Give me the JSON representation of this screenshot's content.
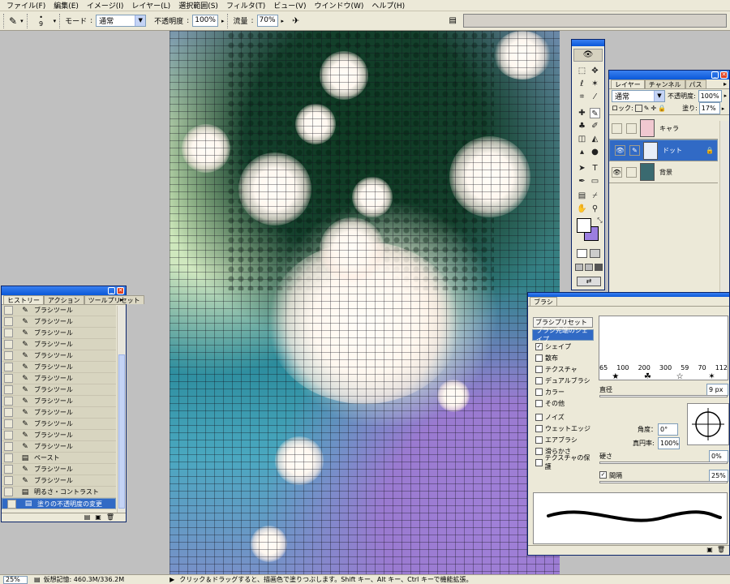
{
  "menu": [
    "ファイル(F)",
    "編集(E)",
    "イメージ(I)",
    "レイヤー(L)",
    "選択範囲(S)",
    "フィルタ(T)",
    "ビュー(V)",
    "ウインドウ(W)",
    "ヘルプ(H)"
  ],
  "options": {
    "brush_size": "9",
    "mode_label": "モード",
    "mode_value": "通常",
    "opacity_label": "不透明度",
    "opacity_value": "100%",
    "flow_label": "流量",
    "flow_value": "70%"
  },
  "history": {
    "tabs": [
      "ヒストリー",
      "アクション",
      "ツールプリセット"
    ],
    "items": [
      {
        "label": "ブラシツール",
        "icon": "brush-icon"
      },
      {
        "label": "ブラシツール",
        "icon": "brush-icon"
      },
      {
        "label": "ブラシツール",
        "icon": "brush-icon"
      },
      {
        "label": "ブラシツール",
        "icon": "brush-icon"
      },
      {
        "label": "ブラシツール",
        "icon": "brush-icon"
      },
      {
        "label": "ブラシツール",
        "icon": "brush-icon"
      },
      {
        "label": "ブラシツール",
        "icon": "brush-icon"
      },
      {
        "label": "ブラシツール",
        "icon": "brush-icon"
      },
      {
        "label": "ブラシツール",
        "icon": "brush-icon"
      },
      {
        "label": "ブラシツール",
        "icon": "brush-icon"
      },
      {
        "label": "ブラシツール",
        "icon": "brush-icon"
      },
      {
        "label": "ブラシツール",
        "icon": "brush-icon"
      },
      {
        "label": "ブラシツール",
        "icon": "brush-icon"
      },
      {
        "label": "ペースト",
        "icon": "document-icon"
      },
      {
        "label": "ブラシツール",
        "icon": "brush-icon"
      },
      {
        "label": "ブラシツール",
        "icon": "brush-icon"
      },
      {
        "label": "明るさ・コントラスト",
        "icon": "document-icon"
      },
      {
        "label": "塗りの不透明度の変更",
        "icon": "document-icon"
      }
    ]
  },
  "layers": {
    "tabs": [
      "レイヤー",
      "チャンネル",
      "パス"
    ],
    "blend": "通常",
    "opacity_label": "不透明度:",
    "opacity_value": "100%",
    "lock_label": "ロック:",
    "fill_label": "塗り:",
    "fill_value": "17%",
    "items": [
      {
        "name": "キャラ",
        "visible": false,
        "selected": false
      },
      {
        "name": "ドット",
        "visible": true,
        "selected": true
      },
      {
        "name": "背景",
        "visible": true,
        "selected": false
      }
    ]
  },
  "brush": {
    "title": "ブラシ",
    "preset_button": "ブラシプリセット",
    "options": [
      {
        "label": "ブラシ先端のシェイプ",
        "checkbox": false,
        "selected": true
      },
      {
        "label": "シェイプ",
        "checkbox": true,
        "checked": true
      },
      {
        "label": "散布",
        "checkbox": true,
        "checked": false
      },
      {
        "label": "テクスチャ",
        "checkbox": true,
        "checked": false
      },
      {
        "label": "デュアルブラシ",
        "checkbox": true,
        "checked": false
      },
      {
        "label": "カラー",
        "checkbox": true,
        "checked": false
      },
      {
        "label": "その他",
        "checkbox": true,
        "checked": false
      },
      {
        "label": "ノイズ",
        "checkbox": true,
        "checked": false
      },
      {
        "label": "ウェットエッジ",
        "checkbox": true,
        "checked": false
      },
      {
        "label": "エアブラシ",
        "checkbox": true,
        "checked": false
      },
      {
        "label": "滑らかさ",
        "checkbox": true,
        "checked": false
      },
      {
        "label": "テクスチャの保護",
        "checkbox": true,
        "checked": false
      }
    ],
    "sizes": [
      "65",
      "100",
      "200",
      "300",
      "59",
      "70",
      "112"
    ],
    "diameter_label": "直径",
    "diameter_value": "9 px",
    "angle_label": "角度：",
    "angle_value": "0°",
    "roundness_label": "真円率:",
    "roundness_value": "100%",
    "hardness_label": "硬さ",
    "hardness_value": "0%",
    "spacing_label": "間隔",
    "spacing_value": "25%"
  },
  "status": {
    "zoom": "25%",
    "memory": "仮想記憶: 460.3M/336.2M",
    "hint": "クリック＆ドラッグすると、描画色で塗りつぶします。Shift キー、Alt キー、Ctrl キーで機能拡張。"
  },
  "colors": {
    "foreground": "#ffffff",
    "background": "#9b7ee0",
    "selection": "#316ac5"
  }
}
